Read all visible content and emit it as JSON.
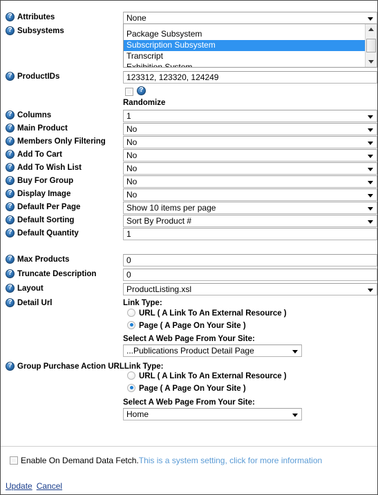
{
  "fields": {
    "attributes": {
      "label": "Attributes",
      "value": "None",
      "icon": "help-icon"
    },
    "subsystems": {
      "label": "Subsystems",
      "icon": "help-icon",
      "options": [
        "Package Subsystem",
        "Subscription Subsystem",
        "Transcript",
        "Exhibition System"
      ],
      "selected": "Subscription Subsystem"
    },
    "product_ids": {
      "label": "ProductIDs",
      "value": "123312, 123320, 124249",
      "icon": "help-icon"
    },
    "randomize": {
      "label": "Randomize",
      "checked": false,
      "icon": "help-icon"
    },
    "columns": {
      "label": "Columns",
      "value": "1",
      "icon": "help-icon"
    },
    "main_product": {
      "label": "Main Product",
      "value": "No",
      "icon": "help-icon"
    },
    "members_only_filtering": {
      "label": "Members Only Filtering",
      "value": "No",
      "icon": "help-icon"
    },
    "add_to_cart": {
      "label": "Add To Cart",
      "value": "No",
      "icon": "help-icon"
    },
    "add_to_wish_list": {
      "label": "Add To Wish List",
      "value": "No",
      "icon": "help-icon"
    },
    "buy_for_group": {
      "label": "Buy For Group",
      "value": "No",
      "icon": "help-icon"
    },
    "display_image": {
      "label": "Display Image",
      "value": "No",
      "icon": "help-icon"
    },
    "default_per_page": {
      "label": "Default Per Page",
      "value": "Show 10 items per page",
      "icon": "help-icon"
    },
    "default_sorting": {
      "label": "Default Sorting",
      "value": "Sort By Product #",
      "icon": "help-icon"
    },
    "default_quantity": {
      "label": "Default Quantity",
      "value": "1",
      "icon": "help-icon"
    },
    "max_products": {
      "label": "Max Products",
      "value": "0",
      "icon": "help-icon"
    },
    "truncate_description": {
      "label": "Truncate Description",
      "value": "0",
      "icon": "help-icon"
    },
    "layout": {
      "label": "Layout",
      "value": "ProductListing.xsl",
      "icon": "help-icon"
    }
  },
  "detail_url": {
    "label": "Detail Url",
    "icon": "help-icon",
    "link_type_label": "Link Type:",
    "option_url": "URL ( A Link To An External Resource )",
    "option_page": "Page ( A Page On Your Site )",
    "selected_link_type": "page",
    "select_page_label": "Select A Web Page From Your Site:",
    "page_value": "...Publications Product Detail Page"
  },
  "group_purchase": {
    "label": "Group Purchase Action URLLink Type:",
    "icon": "help-icon",
    "option_url": "URL ( A Link To An External Resource )",
    "option_page": "Page ( A Page On Your Site )",
    "selected_link_type": "page",
    "select_page_label": "Select A Web Page From Your Site:",
    "page_value": "Home"
  },
  "on_demand": {
    "checked": false,
    "text": "Enable On Demand Data Fetch.",
    "link_text": "This is a system setting, click for more information",
    "link_color": "#5b9bd5"
  },
  "actions": {
    "update": "Update",
    "cancel": "Cancel"
  }
}
